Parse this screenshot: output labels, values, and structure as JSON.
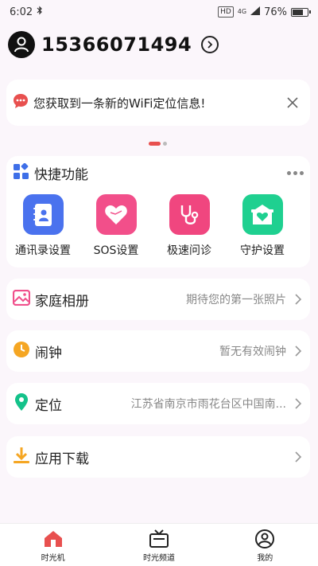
{
  "status_bar": {
    "time": "6:02",
    "hd": "HD",
    "network": "4G",
    "battery_text": "76%",
    "battery_level": 0.76
  },
  "header": {
    "phone": "15366071494"
  },
  "notice": {
    "text": "您获取到一条新的WiFi定位信息!"
  },
  "quick": {
    "title": "快捷功能",
    "items": [
      {
        "label": "通讯录设置",
        "icon": "contacts-icon",
        "color": "#4a72ee"
      },
      {
        "label": "SOS设置",
        "icon": "heart-icon",
        "color": "#f24f8a"
      },
      {
        "label": "极速问诊",
        "icon": "stethoscope-icon",
        "color": "#f0467f"
      },
      {
        "label": "守护设置",
        "icon": "shield-home-icon",
        "color": "#1fd090"
      }
    ]
  },
  "rows": [
    {
      "title": "家庭相册",
      "value": "期待您的第一张照片",
      "icon": "photo-album-icon",
      "color": "#f0508c"
    },
    {
      "title": "闹钟",
      "value": "暂无有效闹钟",
      "icon": "alarm-clock-icon",
      "color": "#f5a623"
    },
    {
      "title": "定位",
      "value": "江苏省南京市雨花台区中国南...",
      "icon": "location-pin-icon",
      "color": "#14c28a"
    },
    {
      "title": "应用下载",
      "value": "",
      "icon": "download-icon",
      "color": "#f5a623"
    }
  ],
  "tabbar": {
    "tabs": [
      {
        "label": "时光机",
        "icon": "home-icon",
        "color": "#e8504f"
      },
      {
        "label": "时光频道",
        "icon": "tv-icon",
        "color": "#222222"
      },
      {
        "label": "我的",
        "icon": "profile-icon",
        "color": "#222222"
      }
    ]
  }
}
